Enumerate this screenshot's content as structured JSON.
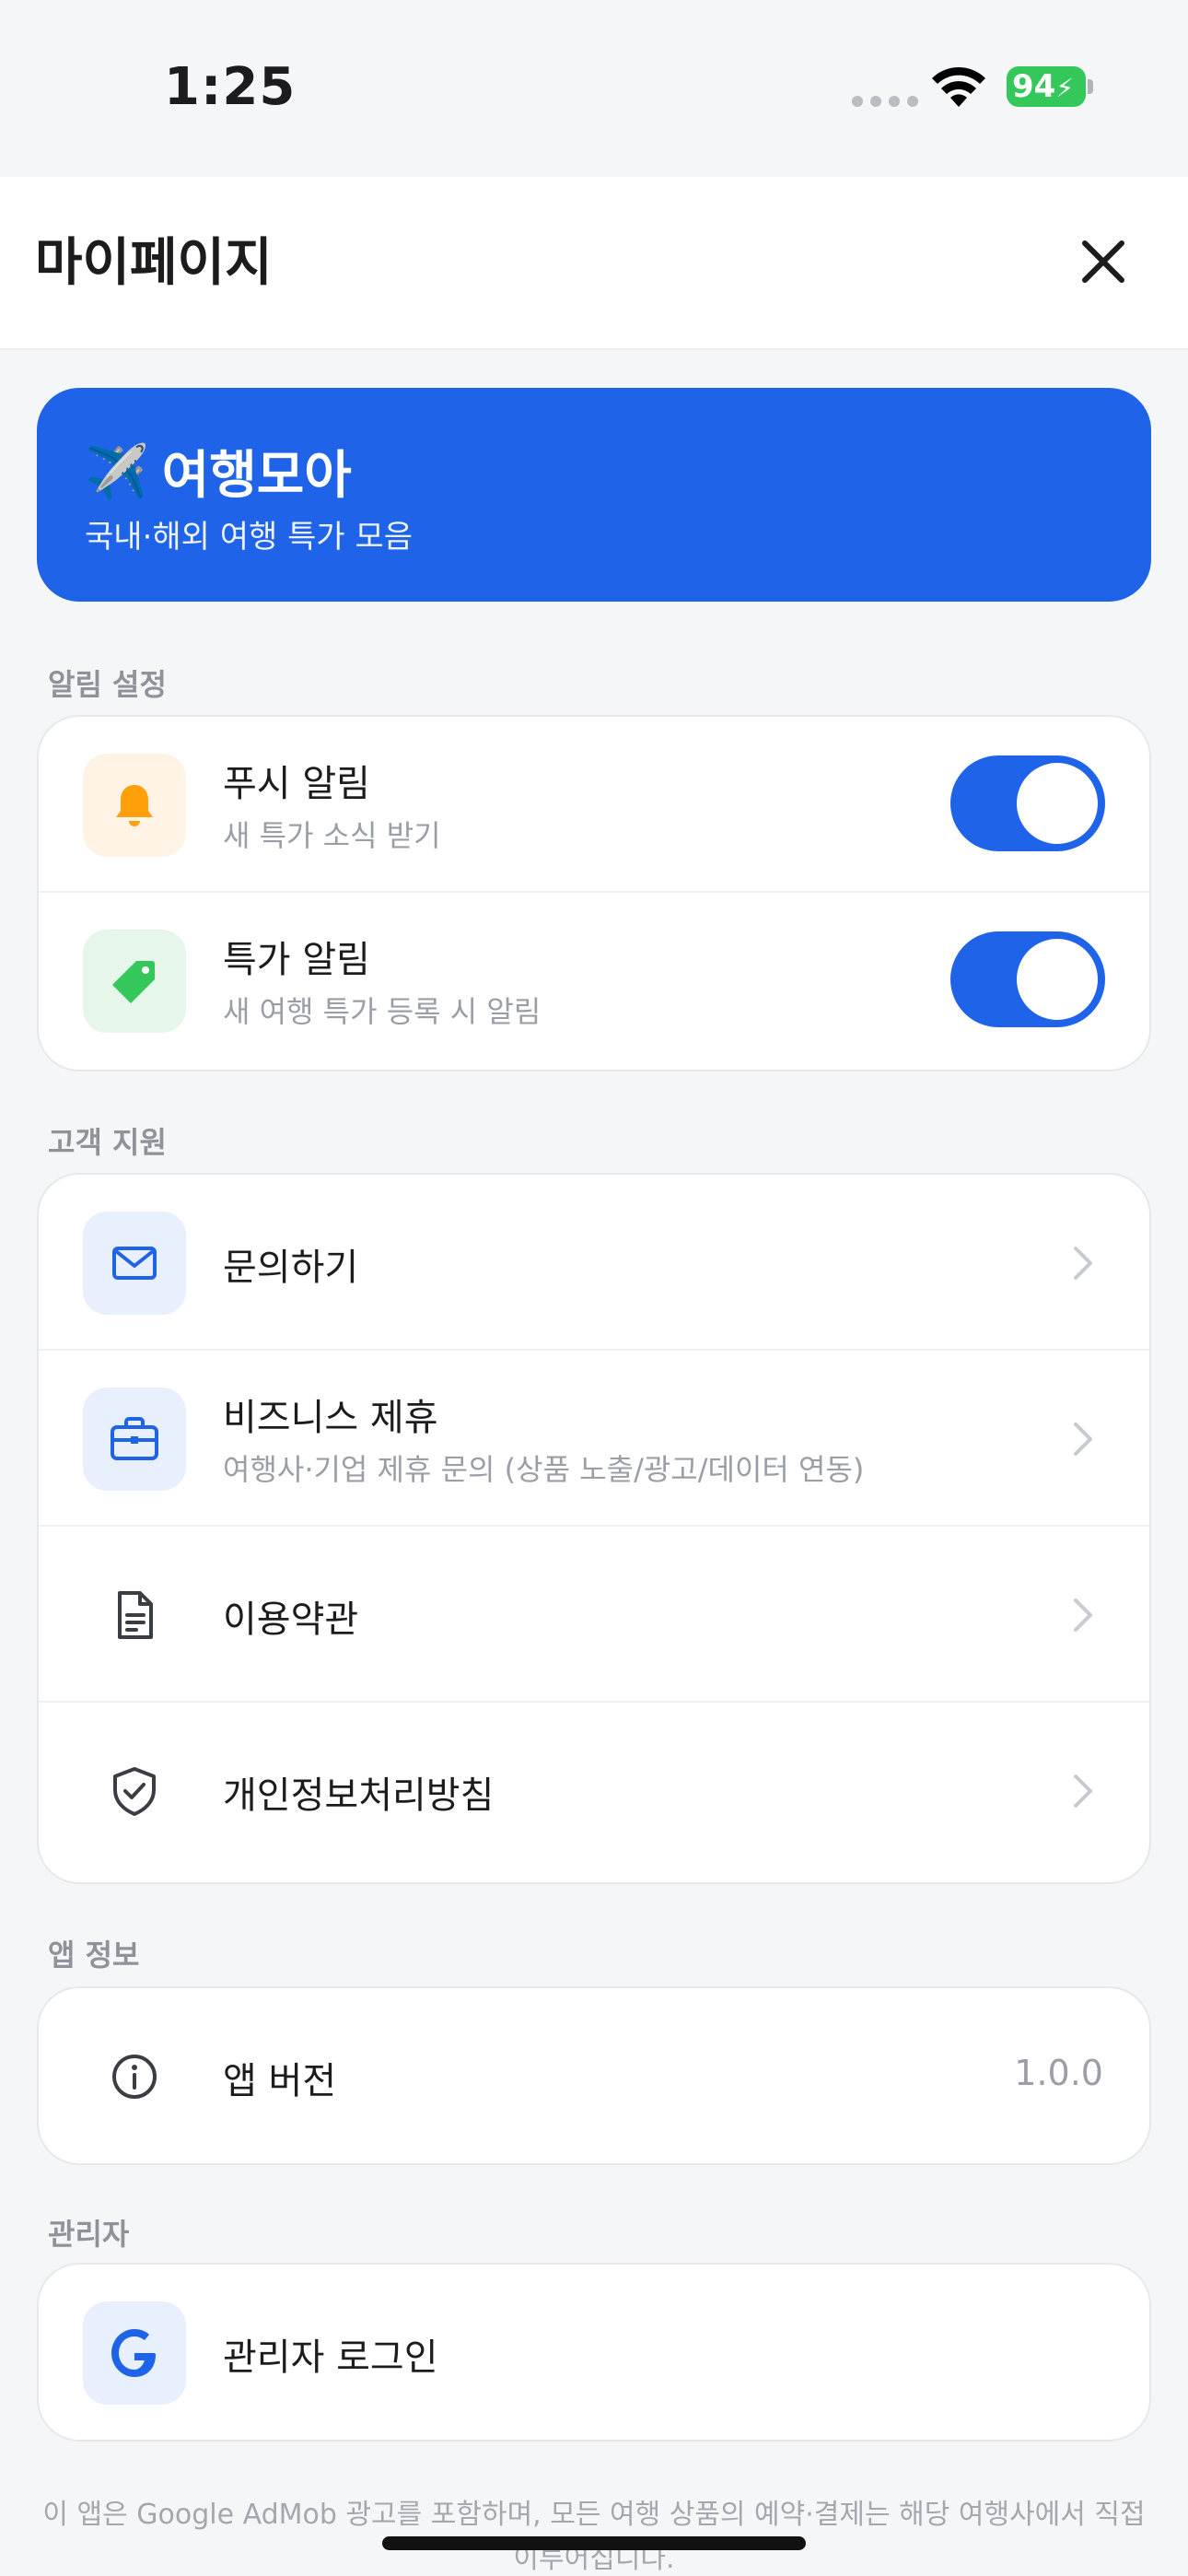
{
  "status_bar": {
    "time": "1:25",
    "battery": "94"
  },
  "header": {
    "title": "마이페이지",
    "close_icon": "close-icon"
  },
  "banner": {
    "emoji": "✈️",
    "title": "여행모아",
    "subtitle": "국내·해외 여행 특가 모음",
    "color": "#1f63e8"
  },
  "notifications": {
    "label": "알림 설정",
    "items": [
      {
        "title": "푸시 알림",
        "subtitle": "새 특가 소식 받기",
        "icon": "bell-icon",
        "enabled": true
      },
      {
        "title": "특가 알림",
        "subtitle": "새 여행 특가 등록 시 알림",
        "icon": "tag-icon",
        "enabled": true
      }
    ]
  },
  "support": {
    "label": "고객 지원",
    "items": [
      {
        "title": "문의하기",
        "icon": "mail-icon"
      },
      {
        "title": "비즈니스 제휴",
        "subtitle": "여행사·기업 제휴 문의 (상품 노출/광고/데이터 연동)",
        "icon": "briefcase-icon"
      },
      {
        "title": "이용약관",
        "icon": "document-icon"
      },
      {
        "title": "개인정보처리방침",
        "icon": "shield-icon"
      }
    ]
  },
  "app_info": {
    "label": "앱 정보",
    "items": [
      {
        "title": "앱 버전",
        "value": "1.0.0",
        "icon": "info-icon"
      }
    ]
  },
  "admin": {
    "label": "관리자",
    "items": [
      {
        "title": "관리자 로그인",
        "icon": "google-icon"
      }
    ]
  },
  "footer": {
    "note": "이 앱은 Google AdMob 광고를 포함하며, 모든 여행 상품의 예약·결제는 해당 여행사에서 직접 이루어집니다."
  },
  "colors": {
    "accent": "#1f63e8",
    "toggle_on": "#1f63e8",
    "battery": "#34c759"
  }
}
